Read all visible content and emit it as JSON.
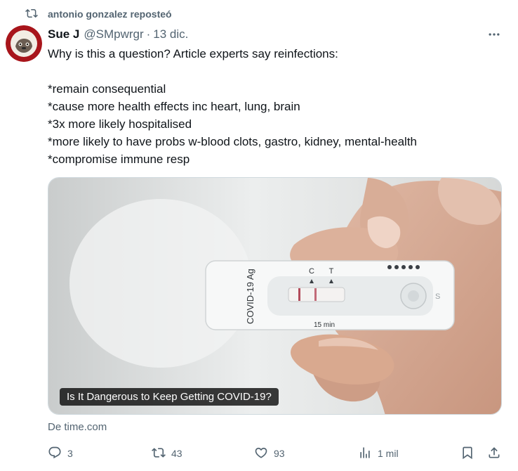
{
  "repost": {
    "text": "antonio gonzalez reposteó",
    "icon": "repost-icon"
  },
  "tweet": {
    "author_name": "Sue J",
    "author_handle": "@SMpwrgr",
    "separator": "·",
    "time": "13 dic.",
    "lines": [
      "Why is this a question? Article experts say reinfections:",
      "",
      "*remain consequential",
      "*cause more health effects inc heart, lung, brain",
      "*3x more likely hospitalised",
      "*more likely to have probs w-blood clots, gastro, kidney, mental-health",
      "*compromise immune resp"
    ]
  },
  "card": {
    "title": "Is It Dangerous to Keep Getting COVID-19?",
    "test_label": "COVID-19 Ag",
    "control_mark": "C",
    "test_mark": "T",
    "timer_label": "15 min",
    "sample_mark": "S",
    "source": "De time.com"
  },
  "actions": {
    "replies": "3",
    "reposts": "43",
    "likes": "93",
    "views": "1 mil"
  },
  "colors": {
    "text": "#0f1419",
    "muted": "#536471",
    "border": "#cfd9de"
  }
}
